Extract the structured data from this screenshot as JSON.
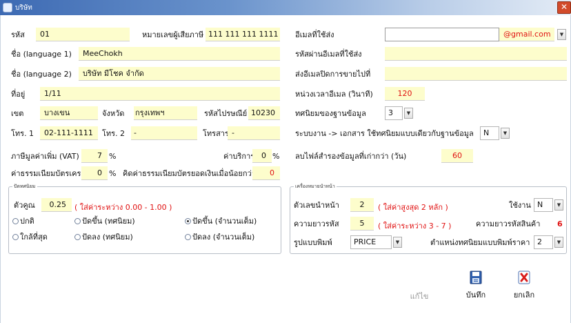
{
  "window": {
    "title": "บริษัท",
    "close_glyph": "✕"
  },
  "left": {
    "code_label": "รหัส",
    "code_value": "01",
    "taxid_label": "หมายเลขผู้เสียภาษี",
    "taxid_value": "111 111 111 1111",
    "name1_label": "ชื่อ (language 1)",
    "name1_value": "MeeChokh",
    "name2_label": "ชื่อ (language 2)",
    "name2_value": "บริษัท มีโชค จำกัด",
    "address_label": "ที่อยู่",
    "address_value": "1/11",
    "district_label": "เขต",
    "district_value": "บางเขน",
    "province_label": "จังหวัด",
    "province_value": "กรุงเทพฯ",
    "postal_label": "รหัสไปรษณีย์",
    "postal_value": "10230",
    "tel1_label": "โทร. 1",
    "tel1_value": "02-111-1111",
    "tel2_label": "โทร. 2",
    "tel2_value": "-",
    "fax_label": "โทรสาร",
    "fax_value": "-",
    "vat_label": "ภาษีมูลค่าเพิ่ม (VAT)",
    "vat_value": "7",
    "service_label": "ค่าบริการ",
    "service_value": "0",
    "cardfee_label": "ค่าธรรมเนียมบัตรเครดิต",
    "cardfee_value": "0",
    "minfee_label": "คิดค่าธรรมเนียมบัตรยอดเงินเมื่อน้อยกว่า",
    "minfee_value": "0",
    "percent_sign": "%"
  },
  "rounding": {
    "title": "ปัดทศนิยม",
    "multiplier_label": "ตัวคูณ",
    "multiplier_value": "0.25",
    "multiplier_hint": "( ใส่ค่าระหว่าง 0.00 - 1.00 )",
    "options": [
      {
        "label": "ปกติ",
        "selected": false
      },
      {
        "label": "ปัดขึ้น (ทศนิยม)",
        "selected": false
      },
      {
        "label": "ปัดขึ้น (จำนวนเต็ม)",
        "selected": true
      },
      {
        "label": "ใกล้ที่สุด",
        "selected": false
      },
      {
        "label": "ปัดลง (ทศนิยม)",
        "selected": false
      },
      {
        "label": "ปัดลง (จำนวนเต็ม)",
        "selected": false
      }
    ]
  },
  "right": {
    "email_label": "อีเมลที่ใช้ส่ง",
    "email_value": "",
    "email_domain": "@gmail.com",
    "email_pass_label": "รหัสผ่านอีเมลที่ใช้ส่ง",
    "email_pass_value": "",
    "email_close_label": "ส่งอีเมลปิดการขายไปที่",
    "email_close_value": "",
    "email_delay_label": "หน่วงเวลาอีเมล (วินาที)",
    "email_delay_value": "120",
    "db_decimal_label": "ทศนิยมของฐานข้อมูล",
    "db_decimal_value": "3",
    "doc_decimal_label": "ระบบงาน -> เอกสาร ใช้ทศนิยมแบบเดียวกับฐานข้อมูล",
    "doc_decimal_value": "N",
    "backup_label": "ลบไฟล์สำรองข้อมูลที่เก่ากว่า (วัน)",
    "backup_value": "60"
  },
  "prefix": {
    "title": "เครื่องหมายนำหน้า",
    "prefix_label": "ตัวเลขนำหน้า",
    "prefix_value": "2",
    "prefix_hint": "( ใส่ค่าสูงสุด 2 หลัก )",
    "use_label": "ใช้งาน",
    "use_value": "N",
    "length_label": "ความยาวรหัส",
    "length_value": "5",
    "length_hint": "( ใส่ค่าระหว่าง 3 - 7 )",
    "product_len_label": "ความยาวรหัสสินค้า",
    "product_len_value": "6",
    "print_label": "รูปแบบพิมพ์",
    "print_value": "PRICE",
    "price_decimal_label": "ตำแหน่งทศนิยมแบบพิมพ์ราคา",
    "price_decimal_value": "2"
  },
  "buttons": {
    "edit": "แก้ไข",
    "save": "บันทึก",
    "cancel": "ยกเลิก"
  },
  "colors": {
    "field_bg": "#fdfdcc",
    "accent_red": "#e01010",
    "titlebar": "#3d6ab3"
  }
}
